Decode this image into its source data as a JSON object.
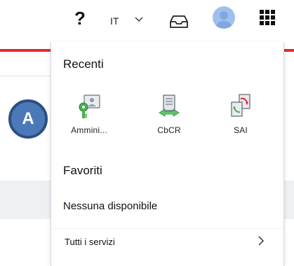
{
  "header": {
    "help_label": "?",
    "language": "IT",
    "icons": [
      "help-icon",
      "chevron-down-icon",
      "inbox-icon",
      "avatar",
      "apps-grid-icon"
    ]
  },
  "menu": {
    "recent_title": "Recenti",
    "recent_items": [
      {
        "label": "Ammini...",
        "icon": "admin-key-icon"
      },
      {
        "label": "CbCR",
        "icon": "cbcr-document-icon"
      },
      {
        "label": "SAI",
        "icon": "sai-document-icon"
      }
    ],
    "favorites_title": "Favoriti",
    "favorites_empty": "Nessuna disponibile",
    "all_services": "Tutti i servizi"
  },
  "annotation": {
    "badge": "A"
  },
  "colors": {
    "accent_red": "#e8282b",
    "badge_blue": "#4b79b8",
    "avatar_blue": "#9fc0ee"
  }
}
